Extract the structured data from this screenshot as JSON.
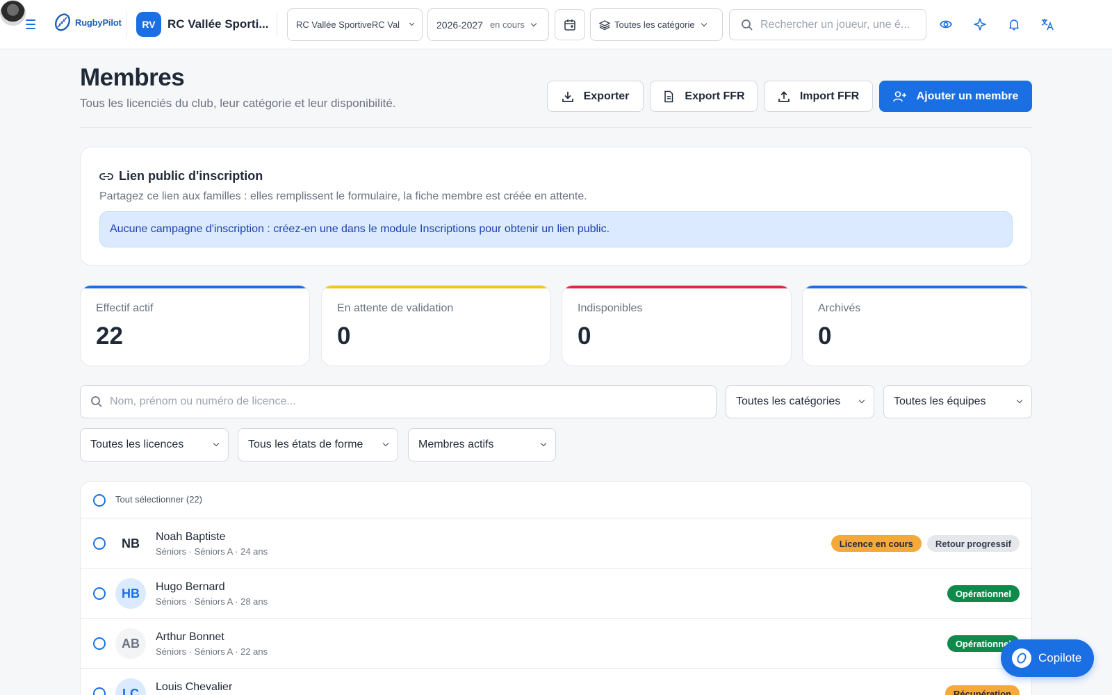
{
  "app": {
    "logo_text": "RugbyPilot",
    "club_initials": "RV",
    "club_name": "RC Vallée Sporti...",
    "club_select": "RC Vallée SportiveRC Val",
    "season": "2026-2027",
    "season_status": "en cours",
    "category_select": "Toutes les catégorie",
    "search_placeholder": "Rechercher un joueur, une é..."
  },
  "page": {
    "title": "Membres",
    "subtitle": "Tous les licenciés du club, leur catégorie et leur disponibilité."
  },
  "actions": {
    "export": "Exporter",
    "export_ffr": "Export FFR",
    "import_ffr": "Import FFR",
    "add_member": "Ajouter un membre"
  },
  "public_link": {
    "title": "Lien public d'inscription",
    "description": "Partagez ce lien aux familles : elles remplissent le formulaire, la fiche membre est créée en attente.",
    "notice": "Aucune campagne d'inscription : créez-en une dans le module Inscriptions pour obtenir un lien public."
  },
  "stats": [
    {
      "label": "Effectif actif",
      "value": "22",
      "color": "#1a6fe3"
    },
    {
      "label": "En attente de validation",
      "value": "0",
      "color": "#f5c518"
    },
    {
      "label": "Indisponibles",
      "value": "0",
      "color": "#d92d3f"
    },
    {
      "label": "Archivés",
      "value": "0",
      "color": "#1a6fe3"
    }
  ],
  "filters": {
    "search_placeholder": "Nom, prénom ou numéro de licence...",
    "categories": "Toutes les catégories",
    "teams": "Toutes les équipes",
    "licences": "Toutes les licences",
    "fitness": "Tous les états de forme",
    "status": "Membres actifs"
  },
  "list": {
    "select_all": "Tout sélectionner (22)",
    "members": [
      {
        "initials": "NB",
        "name": "Noah Baptiste",
        "meta": "Séniors · Séniors A · 24 ans",
        "badges": [
          {
            "text": "Licence en cours",
            "bg": "#f6a93b",
            "fg": "#1f2937"
          },
          {
            "text": "Retour progressif",
            "bg": "#e5e7eb",
            "fg": "#374151"
          }
        ]
      },
      {
        "initials": "HB",
        "name": "Hugo Bernard",
        "meta": "Séniors · Séniors A · 28 ans",
        "badges": [
          {
            "text": "Opérationnel",
            "bg": "#0f8a4b",
            "fg": "#ffffff"
          }
        ]
      },
      {
        "initials": "AB",
        "name": "Arthur Bonnet",
        "meta": "Séniors · Séniors A · 22 ans",
        "badges": [
          {
            "text": "Opérationnel",
            "bg": "#0f8a4b",
            "fg": "#ffffff"
          }
        ]
      },
      {
        "initials": "LC",
        "name": "Louis Chevalier",
        "meta": "",
        "badges": [
          {
            "text": "Récupération",
            "bg": "#f6a93b",
            "fg": "#1f2937"
          }
        ]
      }
    ]
  },
  "copilot": {
    "label": "Copilote"
  },
  "colors": {
    "accent": "#1a6fe3",
    "success": "#0f8a4b",
    "warning": "#f6a93b"
  }
}
